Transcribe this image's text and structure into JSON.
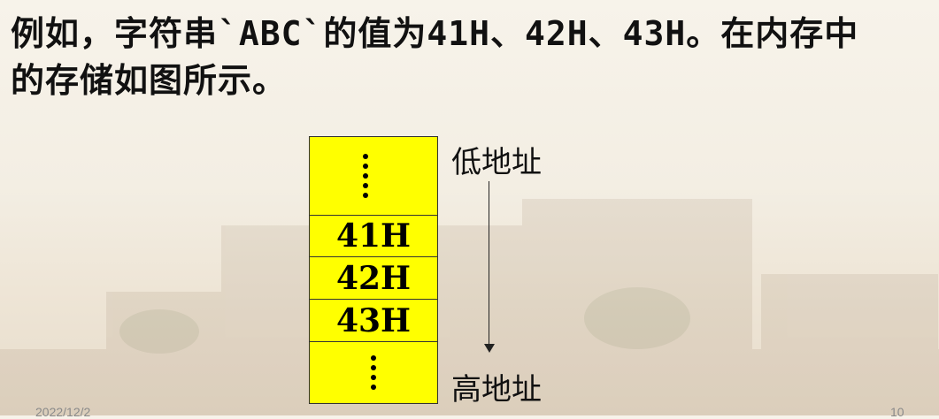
{
  "slide": {
    "text_line_1": "例如，字符串`ABC`的值为41H、42H、43H。在内存中",
    "text_line_2": "的存储如图所示。"
  },
  "memory": {
    "cells": [
      {
        "kind": "ellipsis",
        "value": ""
      },
      {
        "kind": "value",
        "value": "41H"
      },
      {
        "kind": "value",
        "value": "42H"
      },
      {
        "kind": "value",
        "value": "43H"
      },
      {
        "kind": "ellipsis",
        "value": ""
      }
    ],
    "cell_color": "#ffff00"
  },
  "labels": {
    "low_address": "低地址",
    "high_address": "高地址"
  },
  "footer": {
    "date": "2022/12/2",
    "page_number": "10"
  }
}
